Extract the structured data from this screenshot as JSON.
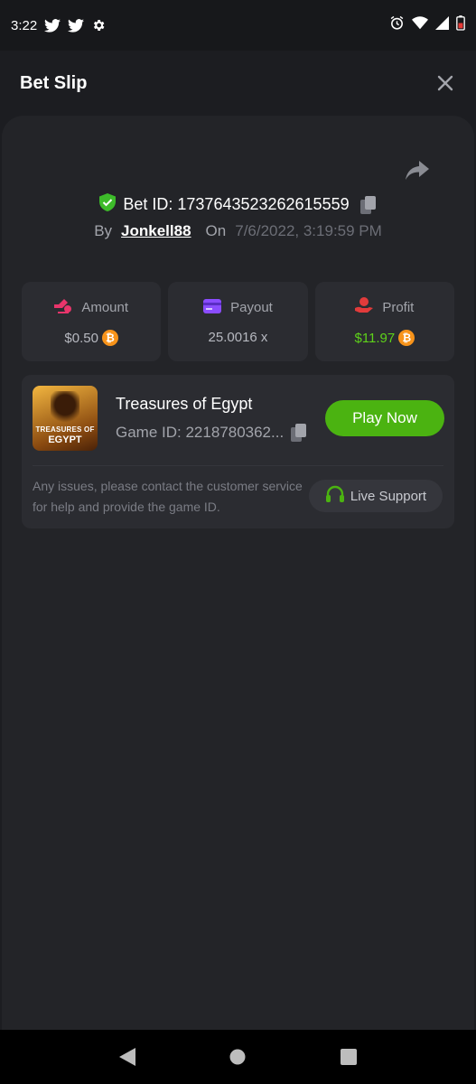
{
  "status_bar": {
    "time": "3:22",
    "icons_left": [
      "twitter-icon",
      "twitter-icon",
      "gear-icon"
    ],
    "icons_right": [
      "alarm-icon",
      "wifi-icon",
      "signal-icon",
      "battery-icon"
    ]
  },
  "header": {
    "title": "Bet Slip",
    "close_icon": "close-icon"
  },
  "bet": {
    "id_label": "Bet ID: 1737643523262615559",
    "by_label": "By",
    "user": "Jonkell88",
    "on_label": "On",
    "date": "7/6/2022, 3:19:59 PM"
  },
  "stats": {
    "amount": {
      "label": "Amount",
      "value": "$0.50"
    },
    "payout": {
      "label": "Payout",
      "value": "25.0016 x"
    },
    "profit": {
      "label": "Profit",
      "value": "$11.97"
    },
    "coin_symbol": "₿"
  },
  "game": {
    "title": "Treasures of Egypt",
    "id_label": "Game ID: 2218780362...",
    "thumb_caption_top": "TREASURES OF",
    "thumb_caption_bottom": "EGYPT",
    "play_label": "Play Now",
    "notice": "Any issues, please contact the customer service for help and provide the game ID.",
    "support_label": "Live Support"
  },
  "colors": {
    "accent_green": "#4bb311",
    "profit_green": "#5ed21a",
    "amount_icon": "#e8356b",
    "payout_icon": "#8b4dff",
    "profit_icon": "#e23b3b",
    "shield_green": "#3dbb2a",
    "btc_orange": "#f7931a"
  }
}
